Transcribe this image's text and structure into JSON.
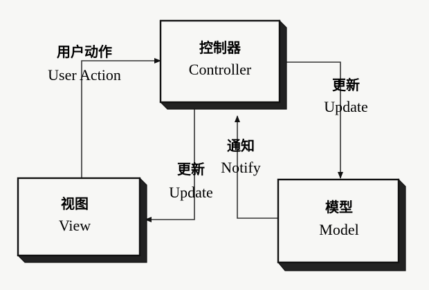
{
  "nodes": {
    "controller": {
      "cn": "控制器",
      "en": "Controller"
    },
    "view": {
      "cn": "视图",
      "en": "View"
    },
    "model": {
      "cn": "模型",
      "en": "Model"
    }
  },
  "edges": {
    "user_action": {
      "cn": "用户动作",
      "en": "User Action"
    },
    "update_model": {
      "cn": "更新",
      "en": "Update"
    },
    "update_view": {
      "cn": "更新",
      "en": "Update"
    },
    "notify": {
      "cn": "通知",
      "en": "Notify"
    }
  }
}
